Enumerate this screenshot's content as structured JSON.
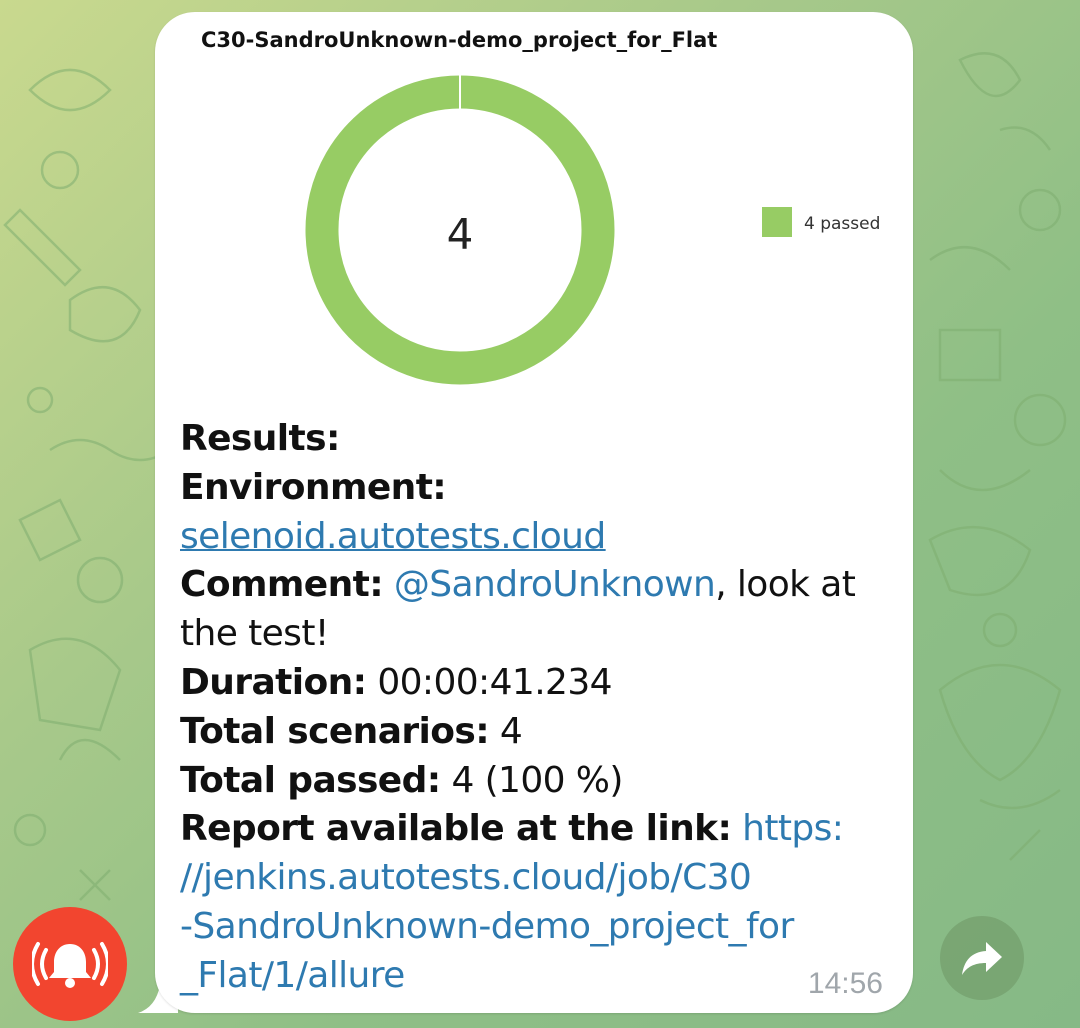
{
  "chat": {
    "background_color": "#a8c98a",
    "message": {
      "chart_title": "C30-SandroUnknown-demo_project_for_Flat",
      "time": "14:56",
      "results_label": "Results:",
      "environment_label": "Environment:",
      "environment_link": "selenoid.autotests.cloud",
      "comment_label": "Comment:",
      "comment_mention": "@SandroUnknown",
      "comment_text_1": ", look at",
      "comment_text_2": "the test!",
      "duration_label": "Duration:",
      "duration_value": "00:00:41.234",
      "scenarios_label": "Total scenarios:",
      "scenarios_value": "4",
      "passed_label": "Total passed:",
      "passed_value": "4 (100 %)",
      "report_label": "Report available at the link:",
      "report_link_lines": [
        "https:",
        "//jenkins.autotests.cloud/job/C30",
        "-SandroUnknown-demo_project_for",
        "_Flat/1/allure"
      ]
    }
  },
  "chart_data": {
    "type": "pie",
    "title": "C30-SandroUnknown-demo_project_for_Flat",
    "center_label": "4",
    "categories": [
      "4 passed"
    ],
    "values": [
      4
    ],
    "colors": [
      "#97cc64"
    ],
    "legend": "right"
  },
  "buttons": {
    "alert_icon": "bell-alert-icon",
    "alert_color": "#f2452f",
    "share_icon": "share-arrow-icon"
  }
}
